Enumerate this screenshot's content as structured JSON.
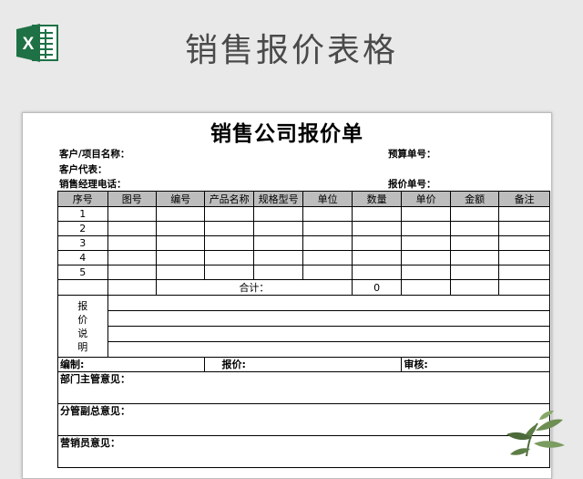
{
  "header": {
    "title": "销售报价表格",
    "icon": "excel-icon",
    "icon_letter": "X",
    "accent": "#1e7145"
  },
  "sheet": {
    "title": "销售公司报价单",
    "info": {
      "customer_label": "客户/项目名称：",
      "rep_label": "客户代表：",
      "manager_phone_label": "销售经理电话：",
      "budget_no_label": "预算单号：",
      "quote_no_label": "报价单号："
    },
    "columns": [
      "序号",
      "图号",
      "编号",
      "产品名称",
      "规格型号",
      "单位",
      "数量",
      "单价",
      "金额",
      "备注"
    ],
    "rows": [
      "1",
      "2",
      "3",
      "4",
      "5"
    ],
    "total_label": "合计：",
    "total_value": "0",
    "note_label": [
      "报",
      "价",
      "说",
      "明"
    ],
    "footer": {
      "prepared_label": "编制:",
      "quote_label": "报价:",
      "review_label": "审核:",
      "dept_opinion": "部门主管意见：",
      "vp_opinion": "分管副总意见：",
      "sales_opinion": "营销员意见："
    }
  }
}
